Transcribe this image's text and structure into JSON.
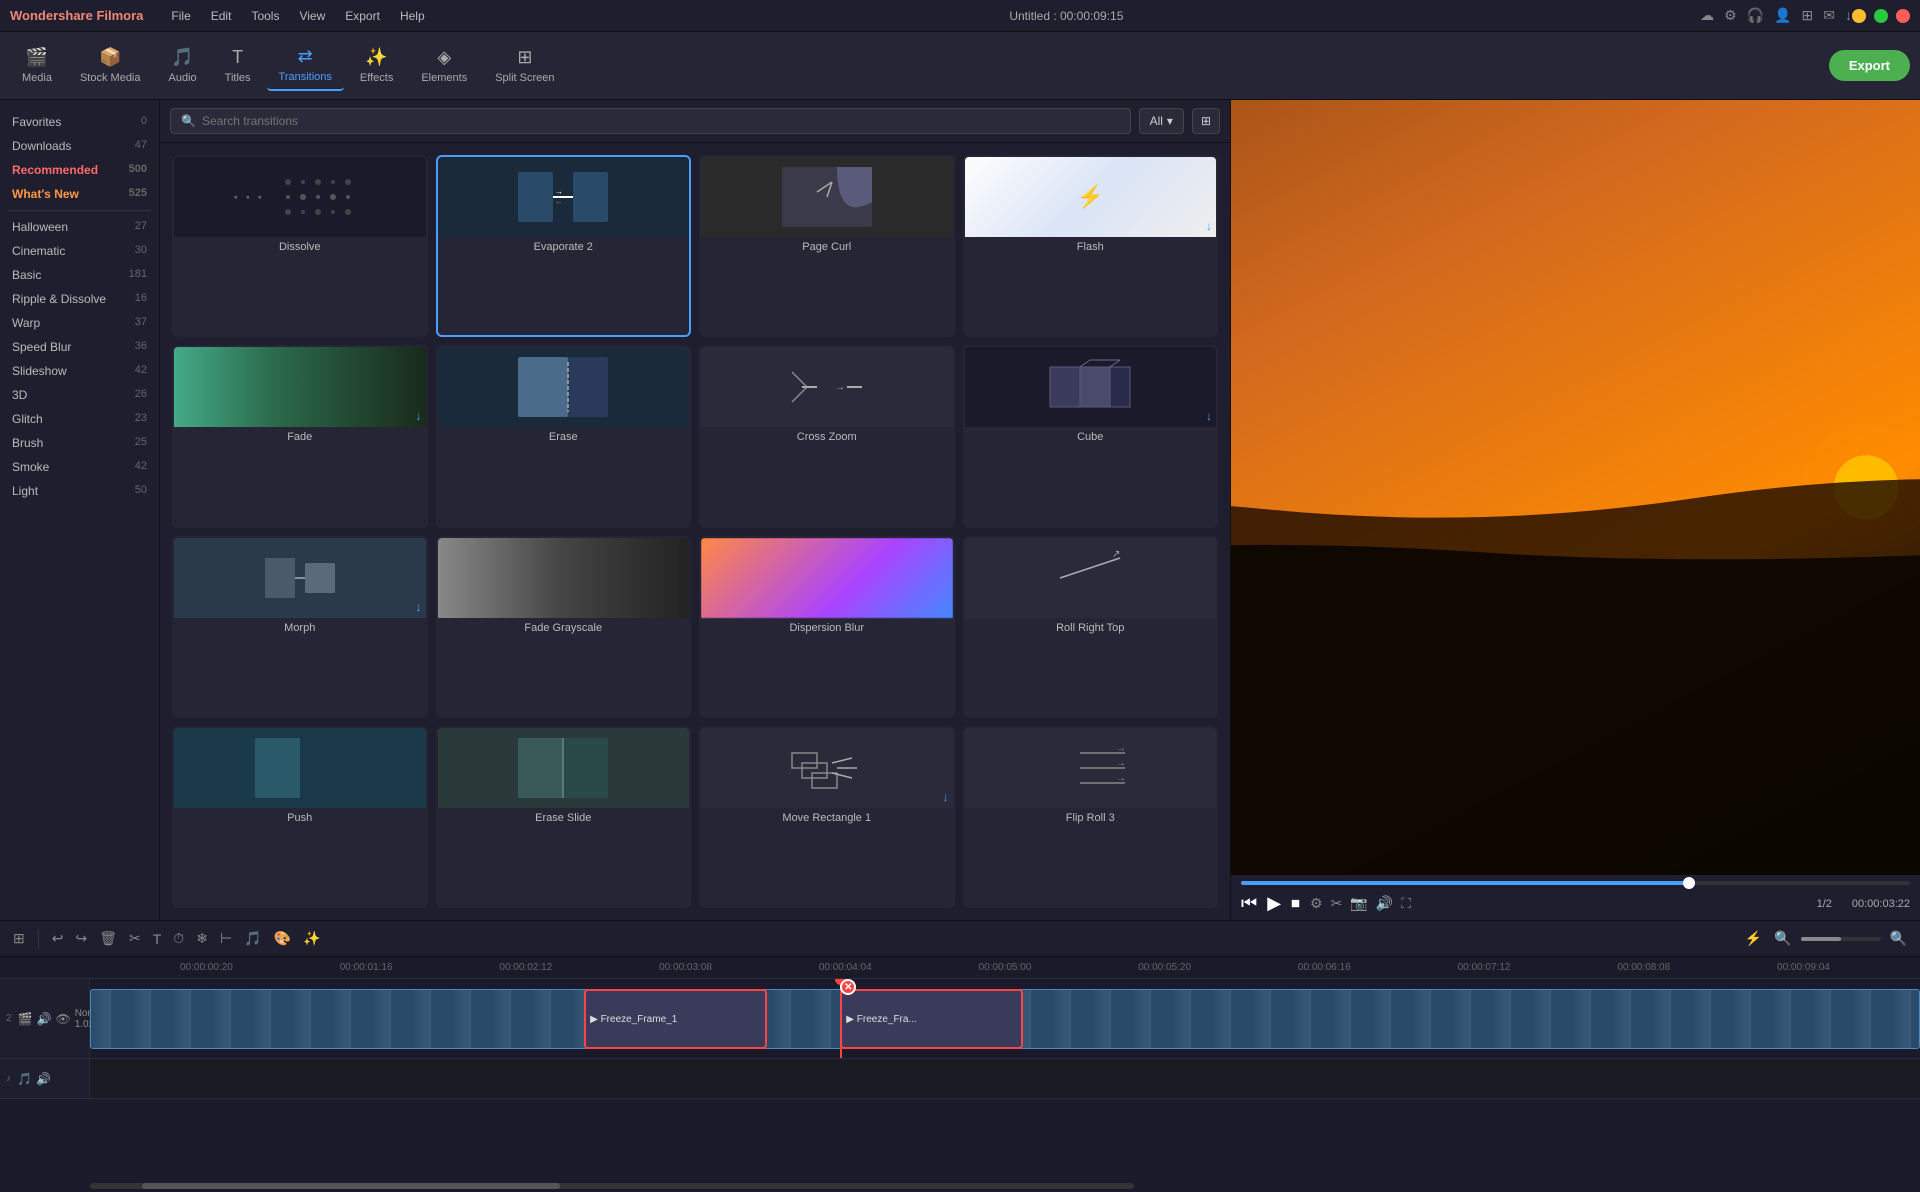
{
  "app": {
    "name": "Wondershare Filmora",
    "title": "Untitled : 00:00:09:15",
    "menu": [
      "File",
      "Edit",
      "Tools",
      "View",
      "Export",
      "Help"
    ]
  },
  "toolbar": {
    "items": [
      {
        "id": "media",
        "icon": "🎬",
        "label": "Media"
      },
      {
        "id": "stock",
        "icon": "📦",
        "label": "Stock Media"
      },
      {
        "id": "audio",
        "icon": "🎵",
        "label": "Audio"
      },
      {
        "id": "titles",
        "icon": "T",
        "label": "Titles"
      },
      {
        "id": "transitions",
        "icon": "⇄",
        "label": "Transitions"
      },
      {
        "id": "effects",
        "icon": "✨",
        "label": "Effects"
      },
      {
        "id": "elements",
        "icon": "◈",
        "label": "Elements"
      },
      {
        "id": "split",
        "icon": "⊞",
        "label": "Split Screen"
      }
    ],
    "active": "transitions",
    "export_label": "Export"
  },
  "sidebar": {
    "items": [
      {
        "id": "favorites",
        "icon": "♡",
        "label": "Favorites",
        "count": "0"
      },
      {
        "id": "downloads",
        "icon": "↓",
        "label": "Downloads",
        "count": "47"
      },
      {
        "id": "recommended",
        "icon": "◆",
        "label": "Recommended",
        "count": "500",
        "special": true
      },
      {
        "id": "whatsnew",
        "icon": "◆",
        "label": "What's New",
        "count": "525",
        "special2": true
      },
      {
        "id": "halloween",
        "icon": "",
        "label": "Halloween",
        "count": "27"
      },
      {
        "id": "cinematic",
        "icon": "",
        "label": "Cinematic",
        "count": "30"
      },
      {
        "id": "basic",
        "icon": "",
        "label": "Basic",
        "count": "181"
      },
      {
        "id": "ripple",
        "icon": "",
        "label": "Ripple & Dissolve",
        "count": "16"
      },
      {
        "id": "warp",
        "icon": "",
        "label": "Warp",
        "count": "37"
      },
      {
        "id": "speedblur",
        "icon": "",
        "label": "Speed Blur",
        "count": "36"
      },
      {
        "id": "slideshow",
        "icon": "",
        "label": "Slideshow",
        "count": "42"
      },
      {
        "id": "3d",
        "icon": "",
        "label": "3D",
        "count": "26"
      },
      {
        "id": "glitch",
        "icon": "",
        "label": "Glitch",
        "count": "23"
      },
      {
        "id": "brush",
        "icon": "",
        "label": "Brush",
        "count": "25"
      },
      {
        "id": "smoke",
        "icon": "",
        "label": "Smoke",
        "count": "42"
      },
      {
        "id": "light",
        "icon": "",
        "label": "Light",
        "count": "50"
      }
    ]
  },
  "transitions": {
    "search_placeholder": "Search transitions",
    "filter_label": "All",
    "items": [
      {
        "id": "dissolve",
        "name": "Dissolve",
        "has_download": false,
        "style": "dots"
      },
      {
        "id": "evaporate2",
        "name": "Evaporate 2",
        "has_download": false,
        "style": "arrows",
        "selected": true
      },
      {
        "id": "page-curl",
        "name": "Page Curl",
        "has_download": false,
        "style": "curl"
      },
      {
        "id": "flash",
        "name": "Flash",
        "has_download": true,
        "style": "flash"
      },
      {
        "id": "fade",
        "name": "Fade",
        "has_download": false,
        "style": "fade"
      },
      {
        "id": "erase",
        "name": "Erase",
        "has_download": false,
        "style": "erase"
      },
      {
        "id": "cross-zoom",
        "name": "Cross Zoom",
        "has_download": false,
        "style": "zoom"
      },
      {
        "id": "cube",
        "name": "Cube",
        "has_download": true,
        "style": "cube"
      },
      {
        "id": "morph",
        "name": "Morph",
        "has_download": false,
        "style": "morph"
      },
      {
        "id": "fade-grayscale",
        "name": "Fade Grayscale",
        "has_download": false,
        "style": "fade-gray"
      },
      {
        "id": "dispersion-blur",
        "name": "Dispersion Blur",
        "has_download": false,
        "style": "dispersion"
      },
      {
        "id": "roll-right-top",
        "name": "Roll Right Top",
        "has_download": false,
        "style": "roll"
      },
      {
        "id": "push",
        "name": "Push",
        "has_download": false,
        "style": "push"
      },
      {
        "id": "erase-slide",
        "name": "Erase Slide",
        "has_download": false,
        "style": "erase-slide"
      },
      {
        "id": "move-rectangle-1",
        "name": "Move Rectangle 1",
        "has_download": true,
        "style": "move-rect"
      },
      {
        "id": "flip-roll-3",
        "name": "Flip Roll 3",
        "has_download": false,
        "style": "flip-roll"
      }
    ]
  },
  "preview": {
    "timecode": "00:00:03:22",
    "fraction": "1/2",
    "progress_percent": 67
  },
  "timeline": {
    "timecodes": [
      "00:00:00:20",
      "00:00:01:16",
      "00:00:02:12",
      "00:00:03:08",
      "00:00:04:04",
      "00:00:05:00",
      "00:00:05:20",
      "00:00:06:16",
      "00:00:07:12",
      "00:00:08:08",
      "00:00:09:04"
    ],
    "playhead_time": "00:00:04:04",
    "clips": [
      {
        "label": "▶ Freeze_Frame_1",
        "type": "freeze",
        "start_pct": 27,
        "width_pct": 10
      },
      {
        "label": "▶ Freeze_Fra...",
        "type": "freeze",
        "start_pct": 41,
        "width_pct": 10
      }
    ]
  }
}
